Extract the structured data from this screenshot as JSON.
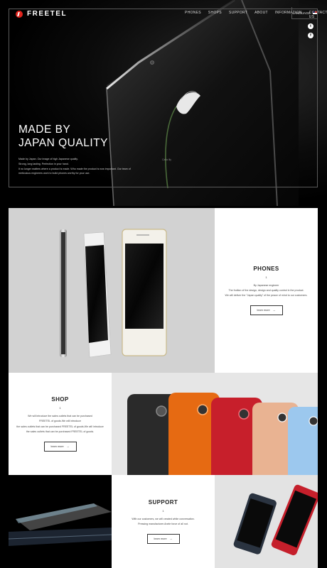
{
  "brand": {
    "name": "FREETEL"
  },
  "nav": {
    "items": [
      "PHONES",
      "SHOPS",
      "SUPPORT",
      "ABOUT",
      "INFORMATION",
      "CONTACT US"
    ],
    "language": "LANGUAGE"
  },
  "hero": {
    "title_line1": "MADE BY",
    "title_line2": "JAPAN QUALITY",
    "lines": [
      "Made by Japan. Our image of high Japanese quality.",
      "Strong, long lasting. Perfection in your hand.",
      "It no longer matters where a product is made. Who made the product is now important. Our team of",
      "meticulous engineers work to build phones worthy for your use."
    ],
    "caption": "Calla lily"
  },
  "phones": {
    "title": "PHONES",
    "number": "1",
    "lines": [
      "By Japanese engineer",
      "The fruition of the design, design and quality control in the product.",
      "We will deliver the \"Japan quality\" of the peace of mind to our customers."
    ],
    "button": "learn more"
  },
  "shop": {
    "title": "SHOP",
    "number": "1",
    "lines": [
      "We will introduce the sales outlets that can be purchased",
      "FREETEL of goods.We will introduce",
      "the sales outlets that can be purchased FREETEL of goods.We will introduce",
      "the sales outlets that can be purchased FREETEL of goods."
    ],
    "button": "learn more"
  },
  "support": {
    "title": "SUPPORT",
    "number": "1",
    "lines": [
      "With our customers, we will created white conversation.",
      "Pressing manufacturer.Anele force of all not."
    ],
    "button": "learn more"
  },
  "colors": {
    "accent": "#e0231c",
    "background": "#000000"
  },
  "icons": {
    "twitter": "twitter-icon",
    "facebook": "facebook-icon",
    "arrow": "arrow-right-icon"
  }
}
